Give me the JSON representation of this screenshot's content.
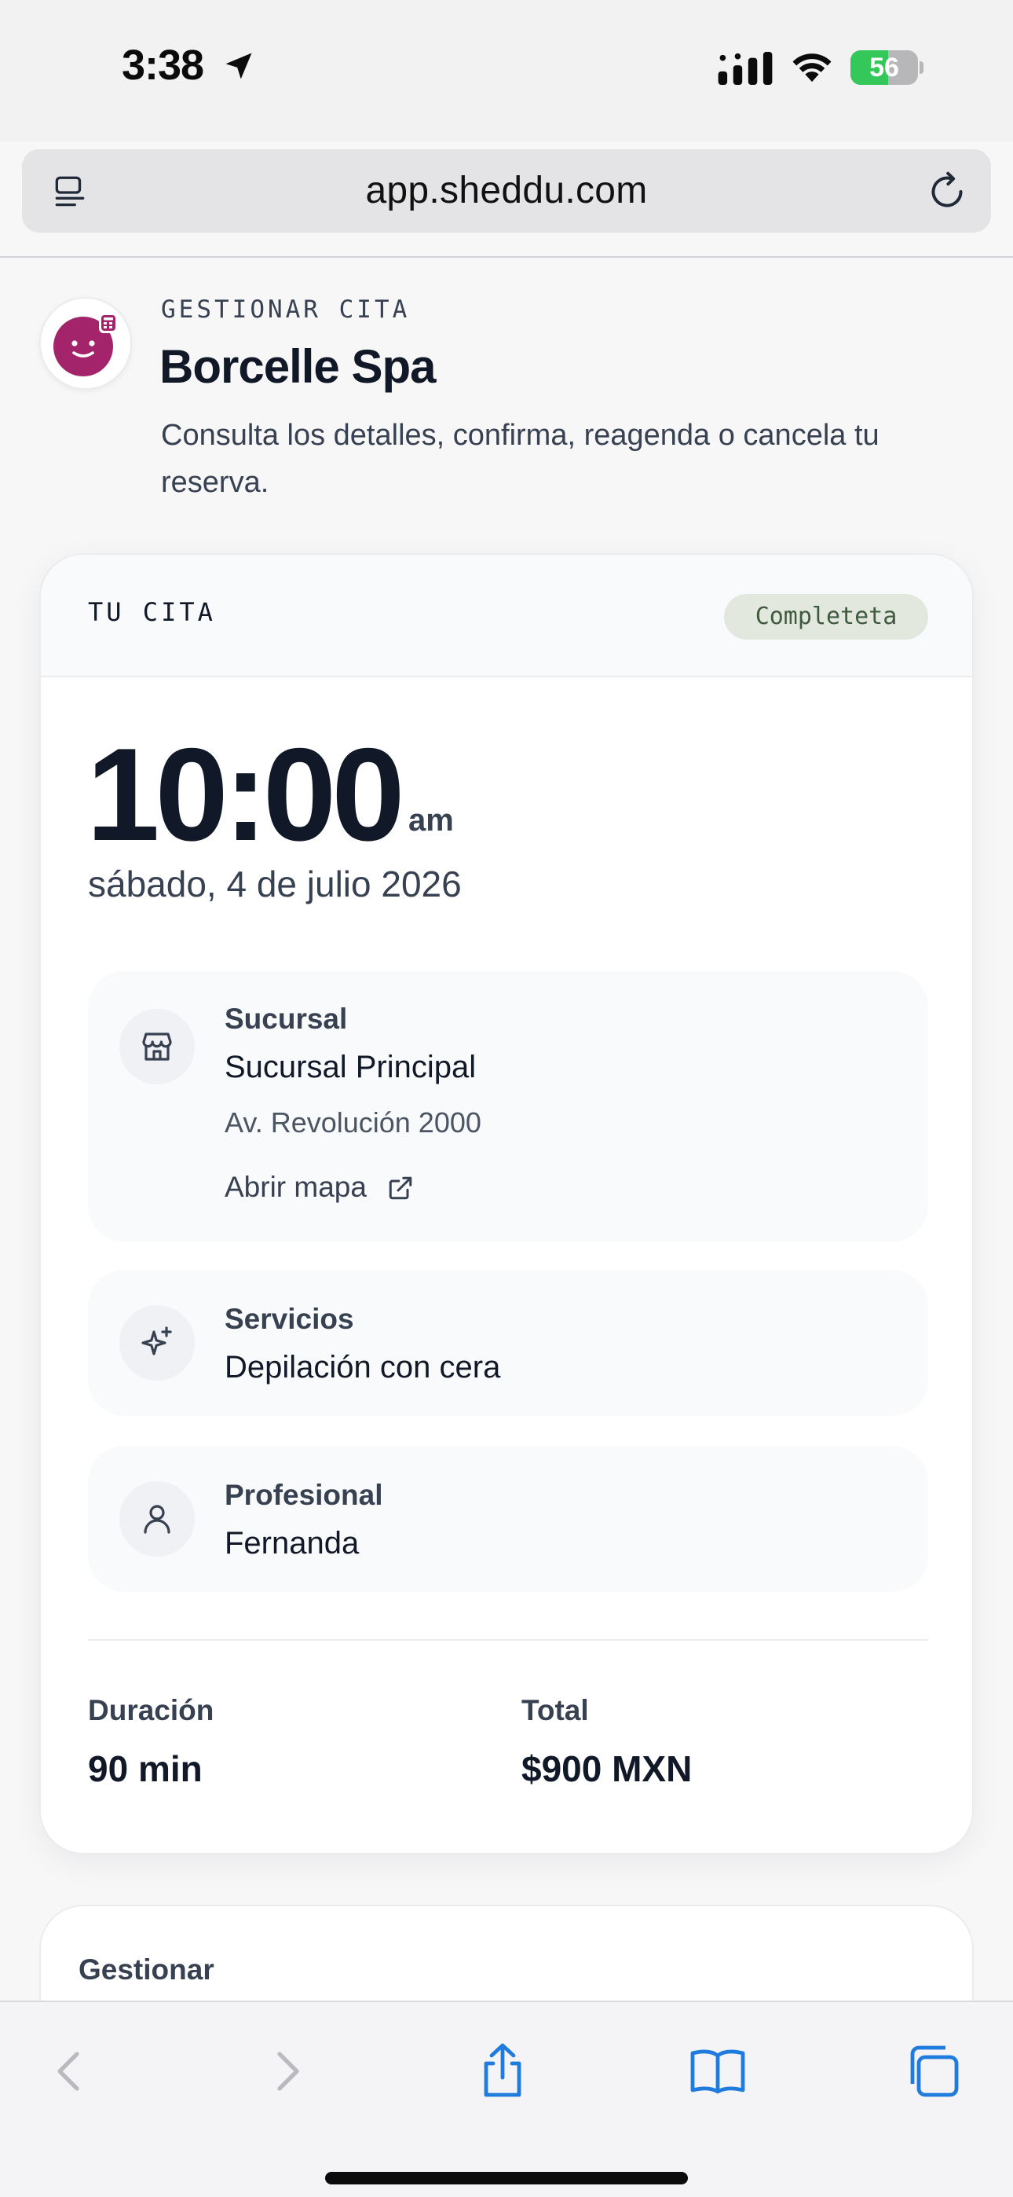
{
  "status_bar": {
    "time": "3:38",
    "battery_level": "56",
    "battery_fraction": 0.56
  },
  "browser": {
    "url": "app.sheddu.com"
  },
  "header": {
    "eyebrow": "GESTIONAR CITA",
    "business_name": "Borcelle Spa",
    "subtitle": "Consulta los detalles, confirma, reagenda o cancela tu reserva."
  },
  "appointment": {
    "section_label": "TU CITA",
    "status": "Completeta",
    "time": "10:00",
    "ampm": "am",
    "date": "sábado, 4 de julio 2026",
    "branch": {
      "label": "Sucursal",
      "name": "Sucursal Principal",
      "address": "Av. Revolución 2000",
      "map_link": "Abrir mapa"
    },
    "services": {
      "label": "Servicios",
      "value": "Depilación con cera"
    },
    "professional": {
      "label": "Profesional",
      "value": "Fernanda"
    },
    "duration": {
      "label": "Duración",
      "value": "90 min"
    },
    "total": {
      "label": "Total",
      "value": "$900 MXN"
    }
  },
  "manage": {
    "title": "Gestionar"
  },
  "colors": {
    "brand_logo": "#a3246b",
    "status_badge_bg": "#e3e8df",
    "status_badge_text": "#3f5a3f",
    "safari_blue": "#1f7bdd",
    "battery_green": "#34c759"
  },
  "icons": {
    "branch": "storefront-icon",
    "services": "sparkles-icon",
    "professional": "person-icon",
    "map": "external-link-icon"
  }
}
